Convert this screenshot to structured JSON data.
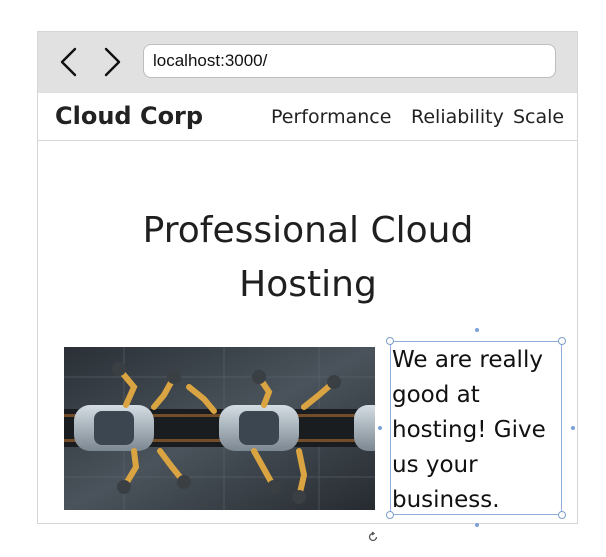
{
  "browser": {
    "url": "localhost:3000/"
  },
  "icons": {
    "back": "chevron-left-icon",
    "forward": "chevron-right-icon",
    "rotate": "rotate-handle-icon"
  },
  "header": {
    "brand": "Cloud Corp",
    "nav": [
      {
        "label": "Performance"
      },
      {
        "label": "Reliability"
      },
      {
        "label": "Scale"
      }
    ]
  },
  "hero": {
    "title": "Professional Cloud Hosting"
  },
  "copy": {
    "text": "We are really good at hosting! Give us your business."
  },
  "colors": {
    "browser_bar": "#e1e1e1",
    "selection": "#7ba2d8",
    "text": "#1f1f1f"
  }
}
